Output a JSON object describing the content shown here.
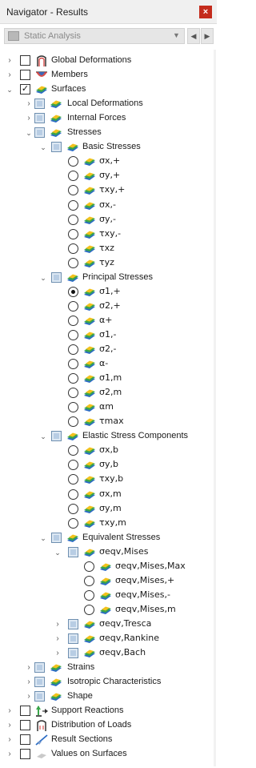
{
  "window": {
    "title": "Navigator - Results",
    "close_glyph": "×"
  },
  "combo": {
    "value": "Static Analysis",
    "dropdown_glyph": "▼",
    "prev_glyph": "◀",
    "next_glyph": "▶"
  },
  "tree": [
    {
      "id": "global-deformations",
      "label": "Global Deformations",
      "level": 0,
      "expander": "collapsed",
      "control": "checkbox",
      "checked": false,
      "icon": "deformation-icon"
    },
    {
      "id": "members",
      "label": "Members",
      "level": 0,
      "expander": "collapsed",
      "control": "checkbox",
      "checked": false,
      "icon": "member-icon"
    },
    {
      "id": "surfaces",
      "label": "Surfaces",
      "level": 0,
      "expander": "expanded",
      "control": "checkbox",
      "checked": true,
      "icon": "surface-icon"
    },
    {
      "id": "local-deformations",
      "label": "Local Deformations",
      "level": 1,
      "expander": "collapsed",
      "control": "checkbox-partial",
      "icon": "surface-icon"
    },
    {
      "id": "internal-forces",
      "label": "Internal Forces",
      "level": 1,
      "expander": "collapsed",
      "control": "checkbox-partial",
      "icon": "surface-icon"
    },
    {
      "id": "stresses",
      "label": "Stresses",
      "level": 1,
      "expander": "expanded",
      "control": "checkbox-partial",
      "icon": "surface-icon"
    },
    {
      "id": "basic-stresses",
      "label": "Basic Stresses",
      "level": 2,
      "expander": "expanded",
      "control": "checkbox-partial",
      "icon": "surface-icon"
    },
    {
      "id": "sx-plus",
      "label": "σx,+",
      "level": 3,
      "control": "radio",
      "selected": false,
      "icon": "surface-icon",
      "greek": true
    },
    {
      "id": "sy-plus",
      "label": "σy,+",
      "level": 3,
      "control": "radio",
      "selected": false,
      "icon": "surface-icon",
      "greek": true
    },
    {
      "id": "txy-plus",
      "label": "τxy,+",
      "level": 3,
      "control": "radio",
      "selected": false,
      "icon": "surface-icon",
      "greek": true
    },
    {
      "id": "sx-minus",
      "label": "σx,-",
      "level": 3,
      "control": "radio",
      "selected": false,
      "icon": "surface-icon",
      "greek": true
    },
    {
      "id": "sy-minus",
      "label": "σy,-",
      "level": 3,
      "control": "radio",
      "selected": false,
      "icon": "surface-icon",
      "greek": true
    },
    {
      "id": "txy-minus",
      "label": "τxy,-",
      "level": 3,
      "control": "radio",
      "selected": false,
      "icon": "surface-icon",
      "greek": true
    },
    {
      "id": "txz",
      "label": "τxz",
      "level": 3,
      "control": "radio",
      "selected": false,
      "icon": "surface-icon",
      "greek": true
    },
    {
      "id": "tyz",
      "label": "τyz",
      "level": 3,
      "control": "radio",
      "selected": false,
      "icon": "surface-icon",
      "greek": true
    },
    {
      "id": "principal-stresses",
      "label": "Principal Stresses",
      "level": 2,
      "expander": "expanded",
      "control": "checkbox-partial",
      "icon": "surface-icon"
    },
    {
      "id": "s1-plus",
      "label": "σ1,+",
      "level": 3,
      "control": "radio",
      "selected": true,
      "icon": "surface-icon",
      "greek": true
    },
    {
      "id": "s2-plus",
      "label": "σ2,+",
      "level": 3,
      "control": "radio",
      "selected": false,
      "icon": "surface-icon",
      "greek": true
    },
    {
      "id": "alpha-plus",
      "label": "α+",
      "level": 3,
      "control": "radio",
      "selected": false,
      "icon": "surface-icon",
      "greek": true
    },
    {
      "id": "s1-minus",
      "label": "σ1,-",
      "level": 3,
      "control": "radio",
      "selected": false,
      "icon": "surface-icon",
      "greek": true
    },
    {
      "id": "s2-minus",
      "label": "σ2,-",
      "level": 3,
      "control": "radio",
      "selected": false,
      "icon": "surface-icon",
      "greek": true
    },
    {
      "id": "alpha-minus",
      "label": "α-",
      "level": 3,
      "control": "radio",
      "selected": false,
      "icon": "surface-icon",
      "greek": true
    },
    {
      "id": "s1-m",
      "label": "σ1,m",
      "level": 3,
      "control": "radio",
      "selected": false,
      "icon": "surface-icon",
      "greek": true
    },
    {
      "id": "s2-m",
      "label": "σ2,m",
      "level": 3,
      "control": "radio",
      "selected": false,
      "icon": "surface-icon",
      "greek": true
    },
    {
      "id": "alpha-m",
      "label": "αm",
      "level": 3,
      "control": "radio",
      "selected": false,
      "icon": "surface-icon",
      "greek": true
    },
    {
      "id": "tmax",
      "label": "τmax",
      "level": 3,
      "control": "radio",
      "selected": false,
      "icon": "surface-icon",
      "greek": true
    },
    {
      "id": "elastic-stress-components",
      "label": "Elastic Stress Components",
      "level": 2,
      "expander": "expanded",
      "control": "checkbox-partial",
      "icon": "surface-icon"
    },
    {
      "id": "sx-b",
      "label": "σx,b",
      "level": 3,
      "control": "radio",
      "selected": false,
      "icon": "surface-icon",
      "greek": true
    },
    {
      "id": "sy-b",
      "label": "σy,b",
      "level": 3,
      "control": "radio",
      "selected": false,
      "icon": "surface-icon",
      "greek": true
    },
    {
      "id": "txy-b",
      "label": "τxy,b",
      "level": 3,
      "control": "radio",
      "selected": false,
      "icon": "surface-icon",
      "greek": true
    },
    {
      "id": "sx-m",
      "label": "σx,m",
      "level": 3,
      "control": "radio",
      "selected": false,
      "icon": "surface-icon",
      "greek": true
    },
    {
      "id": "sy-m",
      "label": "σy,m",
      "level": 3,
      "control": "radio",
      "selected": false,
      "icon": "surface-icon",
      "greek": true
    },
    {
      "id": "txy-m",
      "label": "τxy,m",
      "level": 3,
      "control": "radio",
      "selected": false,
      "icon": "surface-icon",
      "greek": true
    },
    {
      "id": "equivalent-stresses",
      "label": "Equivalent Stresses",
      "level": 2,
      "expander": "expanded",
      "control": "checkbox-partial",
      "icon": "surface-icon"
    },
    {
      "id": "seqv-mises",
      "label": "σeqv,Mises",
      "level": 3,
      "expander": "expanded",
      "control": "checkbox-partial",
      "icon": "surface-icon",
      "greek": true
    },
    {
      "id": "seqv-mises-max",
      "label": "σeqv,Mises,Max",
      "level": 4,
      "control": "radio",
      "selected": false,
      "icon": "surface-icon",
      "greek": true
    },
    {
      "id": "seqv-mises-plus",
      "label": "σeqv,Mises,+",
      "level": 4,
      "control": "radio",
      "selected": false,
      "icon": "surface-icon",
      "greek": true
    },
    {
      "id": "seqv-mises-minus",
      "label": "σeqv,Mises,-",
      "level": 4,
      "control": "radio",
      "selected": false,
      "icon": "surface-icon",
      "greek": true
    },
    {
      "id": "seqv-mises-m",
      "label": "σeqv,Mises,m",
      "level": 4,
      "control": "radio",
      "selected": false,
      "icon": "surface-icon",
      "greek": true
    },
    {
      "id": "seqv-tresca",
      "label": "σeqv,Tresca",
      "level": 3,
      "expander": "collapsed",
      "control": "checkbox-partial",
      "icon": "surface-icon",
      "greek": true
    },
    {
      "id": "seqv-rankine",
      "label": "σeqv,Rankine",
      "level": 3,
      "expander": "collapsed",
      "control": "checkbox-partial",
      "icon": "surface-icon",
      "greek": true
    },
    {
      "id": "seqv-bach",
      "label": "σeqv,Bach",
      "level": 3,
      "expander": "collapsed",
      "control": "checkbox-partial",
      "icon": "surface-icon",
      "greek": true
    },
    {
      "id": "strains",
      "label": "Strains",
      "level": 1,
      "expander": "collapsed",
      "control": "checkbox-partial",
      "icon": "surface-icon"
    },
    {
      "id": "isotropic-characteristics",
      "label": "Isotropic Characteristics",
      "level": 1,
      "expander": "collapsed",
      "control": "checkbox-partial",
      "icon": "surface-icon"
    },
    {
      "id": "shape",
      "label": "Shape",
      "level": 1,
      "expander": "collapsed",
      "control": "checkbox-partial",
      "icon": "surface-icon"
    },
    {
      "id": "support-reactions",
      "label": "Support Reactions",
      "level": 0,
      "expander": "collapsed",
      "control": "checkbox",
      "checked": false,
      "icon": "support-icon"
    },
    {
      "id": "distribution-of-loads",
      "label": "Distribution of Loads",
      "level": 0,
      "expander": "collapsed",
      "control": "checkbox",
      "checked": false,
      "icon": "load-distribution-icon"
    },
    {
      "id": "result-sections",
      "label": "Result Sections",
      "level": 0,
      "expander": "collapsed",
      "control": "checkbox",
      "checked": false,
      "icon": "section-icon"
    },
    {
      "id": "values-on-surfaces",
      "label": "Values on Surfaces",
      "level": 0,
      "expander": "collapsed",
      "control": "checkbox",
      "checked": false,
      "icon": "values-icon"
    }
  ],
  "colors": {
    "close_button": "#c42b1c",
    "partial_check": "#b8cde4",
    "surface_blue": "#2b6cc4",
    "surface_green": "#3aa64a",
    "surface_yellow": "#f2c21b",
    "member_red": "#d0312d"
  }
}
